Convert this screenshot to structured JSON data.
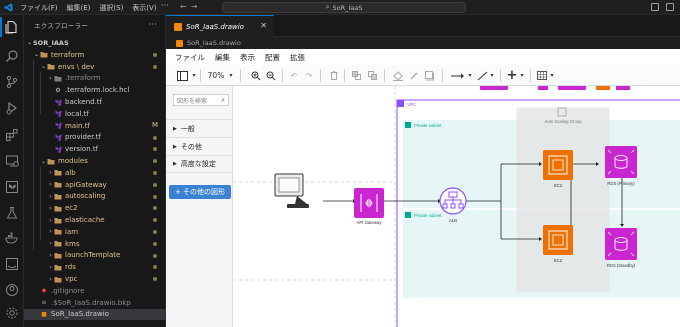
{
  "titlebar": {
    "menu": [
      "ファイル(F)",
      "編集(E)",
      "選択(S)",
      "表示(V)"
    ],
    "more": "···",
    "search": "SoR_IaaS"
  },
  "explorer": {
    "header": "エクスプローラー",
    "more": "···",
    "root": "SOR_IAAS",
    "items": [
      {
        "label": "terraform",
        "depth": 1,
        "kind": "folder",
        "open": true,
        "status": "dot"
      },
      {
        "label": "envs \\ dev",
        "depth": 2,
        "kind": "folder",
        "open": true,
        "status": "dot"
      },
      {
        "label": ".terraform",
        "depth": 3,
        "kind": "folder-dim",
        "open": false,
        "status": ""
      },
      {
        "label": ".terraform.lock.hcl",
        "depth": 3,
        "kind": "lock",
        "open": false,
        "status": ""
      },
      {
        "label": "backend.tf",
        "depth": 3,
        "kind": "tf",
        "open": false,
        "status": ""
      },
      {
        "label": "local.tf",
        "depth": 3,
        "kind": "tf",
        "open": false,
        "status": ""
      },
      {
        "label": "main.tf",
        "depth": 3,
        "kind": "tf",
        "open": false,
        "status": "M"
      },
      {
        "label": "provider.tf",
        "depth": 3,
        "kind": "tf",
        "open": false,
        "status": "dot"
      },
      {
        "label": "version.tf",
        "depth": 3,
        "kind": "tf",
        "open": false,
        "status": "dot"
      },
      {
        "label": "modules",
        "depth": 2,
        "kind": "folder",
        "open": true,
        "status": "dot"
      },
      {
        "label": "alb",
        "depth": 3,
        "kind": "folder",
        "open": false,
        "status": "dot"
      },
      {
        "label": "apiGateway",
        "depth": 3,
        "kind": "folder",
        "open": false,
        "status": "dot"
      },
      {
        "label": "autoscaling",
        "depth": 3,
        "kind": "folder",
        "open": false,
        "status": "dot"
      },
      {
        "label": "ec2",
        "depth": 3,
        "kind": "folder",
        "open": false,
        "status": "dot"
      },
      {
        "label": "elasticache",
        "depth": 3,
        "kind": "folder",
        "open": false,
        "status": "dot"
      },
      {
        "label": "iam",
        "depth": 3,
        "kind": "folder",
        "open": false,
        "status": "dot"
      },
      {
        "label": "kms",
        "depth": 3,
        "kind": "folder",
        "open": false,
        "status": "dot"
      },
      {
        "label": "launchTemplate",
        "depth": 3,
        "kind": "folder",
        "open": false,
        "status": "dot"
      },
      {
        "label": "rds",
        "depth": 3,
        "kind": "folder",
        "open": false,
        "status": "dot"
      },
      {
        "label": "vpc",
        "depth": 3,
        "kind": "folder",
        "open": false,
        "status": "dot"
      },
      {
        "label": ".gitignore",
        "depth": 1,
        "kind": "git",
        "open": false,
        "status": ""
      },
      {
        "label": ".$SoR_IaaS.drawio.bkp",
        "depth": 1,
        "kind": "file",
        "open": false,
        "status": ""
      },
      {
        "label": "SoR_IaaS.drawio",
        "depth": 1,
        "kind": "drawio",
        "open": false,
        "status": "",
        "selected": true
      }
    ]
  },
  "tab": {
    "label": "SoR_IaaS.drawio",
    "close": "✕"
  },
  "breadcrumb": "SoR_IaaS.drawio",
  "drawio": {
    "menu": [
      "ファイル",
      "編集",
      "表示",
      "配置",
      "拡張"
    ],
    "zoom": "70%",
    "search_placeholder": "図形を検索",
    "categories": [
      "一般",
      "その他",
      "高度な設定"
    ],
    "more_shapes": "+ その他の図形"
  },
  "diagram": {
    "vpc_label": "VPC",
    "subnet_label": "Private subnet",
    "asg_label": "Auto Scaling Group",
    "api_label": "API Gateway",
    "alb_label": "ALB",
    "ec2_label": "EC2",
    "rds_primary": "RDS (Primary)",
    "rds_standby": "RDS (Standby)"
  },
  "colors": {
    "accent": "#0078d4",
    "drawio_orange": "#f08705",
    "aws_pink": "#c925d1",
    "aws_orange": "#ed7100",
    "vpc_border": "#8c4fff",
    "subnet_bg": "#e6f6f7",
    "subnet_label": "#01a88d",
    "modified": "#e2c08d"
  }
}
